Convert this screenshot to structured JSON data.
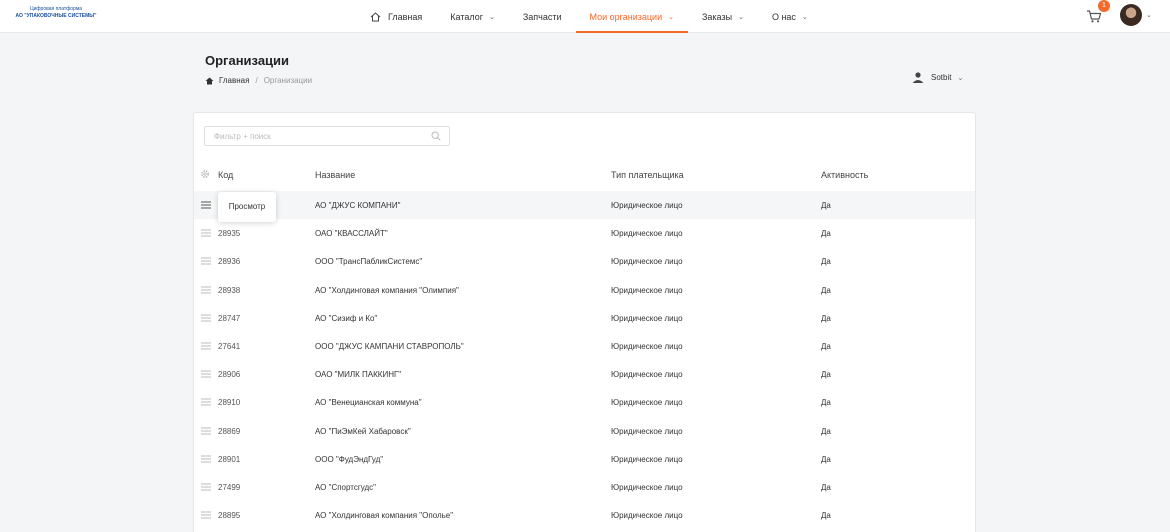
{
  "header": {
    "logo_line1": "Цифровая платформа",
    "logo_line2": "АО \"УПАКОВОЧНЫЕ СИСТЕМЫ\"",
    "nav": [
      {
        "label": "Главная",
        "icon": "home-icon",
        "dropdown": false,
        "active": false
      },
      {
        "label": "Каталог",
        "dropdown": true,
        "active": false
      },
      {
        "label": "Запчасти",
        "dropdown": false,
        "active": false
      },
      {
        "label": "Мои организации",
        "dropdown": true,
        "active": true
      },
      {
        "label": "Заказы",
        "dropdown": true,
        "active": false
      },
      {
        "label": "О нас",
        "dropdown": true,
        "active": false
      }
    ],
    "cart_count": "1",
    "accent_color": "#f26b2a"
  },
  "page": {
    "title": "Организации",
    "breadcrumb": {
      "home": "Главная",
      "current": "Организации"
    },
    "user_selector": "Sotbit"
  },
  "search": {
    "placeholder": "Фильтр + поиск"
  },
  "table": {
    "columns": [
      "Код",
      "Название",
      "Тип плательщика",
      "Активность"
    ],
    "tooltip": "Просмотр",
    "rows": [
      {
        "code": "",
        "name": "АО \"ДЖУС КОМПАНИ\"",
        "type": "Юридическое лицо",
        "active": "Да"
      },
      {
        "code": "28935",
        "name": "ОАО \"КВАССЛАЙТ\"",
        "type": "Юридическое лицо",
        "active": "Да"
      },
      {
        "code": "28936",
        "name": "ООО \"ТрансПабликСистемс\"",
        "type": "Юридическое лицо",
        "active": "Да"
      },
      {
        "code": "28938",
        "name": "АО \"Холдинговая компания \"Олимпия\"",
        "type": "Юридическое лицо",
        "active": "Да"
      },
      {
        "code": "28747",
        "name": "АО \"Сизиф и Ко\"",
        "type": "Юридическое лицо",
        "active": "Да"
      },
      {
        "code": "27641",
        "name": "ООО \"ДЖУС КАМПАНИ СТАВРОПОЛЬ\"",
        "type": "Юридическое лицо",
        "active": "Да"
      },
      {
        "code": "28906",
        "name": "ОАО \"МИЛК ПАККИНГ\"",
        "type": "Юридическое лицо",
        "active": "Да"
      },
      {
        "code": "28910",
        "name": "АО \"Венецианская коммуна\"",
        "type": "Юридическое лицо",
        "active": "Да"
      },
      {
        "code": "28869",
        "name": "АО \"ПиЭмКей Хабаровск\"",
        "type": "Юридическое лицо",
        "active": "Да"
      },
      {
        "code": "28901",
        "name": "ООО \"ФудЭндГуд\"",
        "type": "Юридическое лицо",
        "active": "Да"
      },
      {
        "code": "27499",
        "name": "АО \"Спортсгудс\"",
        "type": "Юридическое лицо",
        "active": "Да"
      },
      {
        "code": "28895",
        "name": "АО \"Холдинговая компания \"Ополье\"",
        "type": "Юридическое лицо",
        "active": "Да"
      }
    ]
  }
}
